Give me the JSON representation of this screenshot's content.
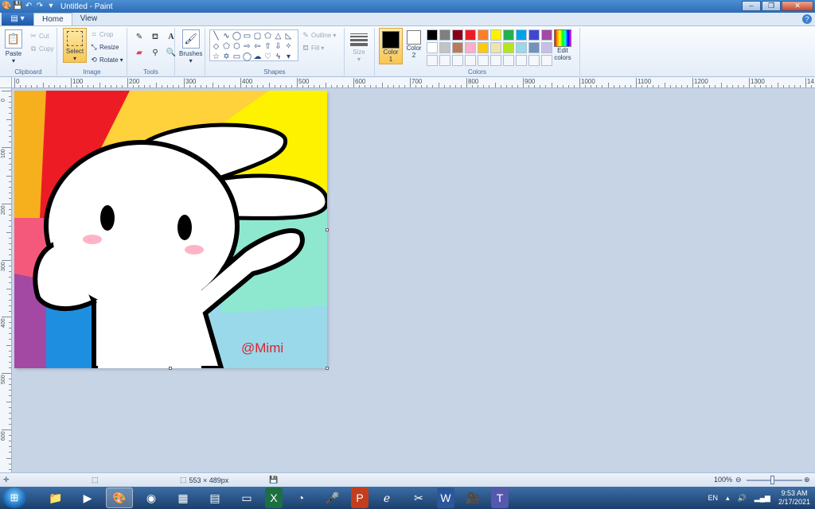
{
  "window": {
    "title": "Untitled - Paint"
  },
  "tabs": {
    "file": "▤ ▾",
    "home": "Home",
    "view": "View"
  },
  "clipboard": {
    "paste": "Paste",
    "cut": "Cut",
    "copy": "Copy",
    "label": "Clipboard"
  },
  "image": {
    "select": "Select",
    "crop": "Crop",
    "resize": "Resize",
    "rotate": "Rotate",
    "label": "Image"
  },
  "tools": {
    "label": "Tools"
  },
  "brushes": {
    "label": "Brushes"
  },
  "shapes": {
    "outline": "Outline",
    "fill": "Fill",
    "label": "Shapes"
  },
  "size": {
    "label": "Size"
  },
  "colors": {
    "color1": "Color 1",
    "color2": "Color 2",
    "edit": "Edit colors",
    "label": "Colors",
    "color1_value": "#000000",
    "color2_value": "#ffffff",
    "palette": [
      "#000000",
      "#7f7f7f",
      "#880015",
      "#ed1c24",
      "#ff7f27",
      "#fff200",
      "#22b14c",
      "#00a2e8",
      "#3f48cc",
      "#a349a4",
      "#ffffff",
      "#c3c3c3",
      "#b97a57",
      "#ffaec9",
      "#ffc90e",
      "#efe4b0",
      "#b5e61d",
      "#99d9ea",
      "#7092be",
      "#c8bfe7",
      "",
      "",
      "",
      "",
      "",
      "",
      "",
      "",
      "",
      ""
    ]
  },
  "ruler": {
    "h_labels": [
      "0",
      "100",
      "200",
      "300",
      "400",
      "500",
      "600",
      "700",
      "800",
      "900",
      "1000",
      "1100",
      "1200",
      "1300",
      "14"
    ],
    "v_labels": [
      "0",
      "100",
      "200",
      "300",
      "400",
      "500",
      "600"
    ]
  },
  "canvas": {
    "watermark": "@Mimi"
  },
  "status": {
    "size": "553 × 489px",
    "zoom": "100%"
  },
  "tray": {
    "lang": "EN",
    "time": "9:53 AM",
    "date": "2/17/2021"
  }
}
